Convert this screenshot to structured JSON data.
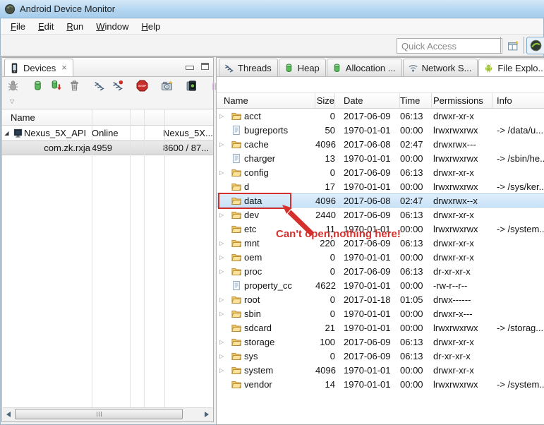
{
  "title_bar": {
    "title": "Android Device Monitor",
    "icon": "app-icon"
  },
  "menu_bar": {
    "items": [
      "File",
      "Edit",
      "Run",
      "Window",
      "Help"
    ]
  },
  "top_toolbar": {
    "quick_access_placeholder": "Quick Access",
    "perspective_button_icon": "open-perspective-icon",
    "ddms_button_icon": "ddms-perspective-icon"
  },
  "devices_panel": {
    "tab_label": "Devices",
    "tab_icon": "phone-icon",
    "toolbar_icons": [
      "debug-process",
      "sep",
      "update-heap",
      "dump-hprof",
      "cause-gc",
      "sep",
      "update-threads",
      "start-method-profiling",
      "sep",
      "stop-process",
      "sep",
      "screen-capture",
      "sep",
      "screen-record",
      "sep",
      "hierarchy-view",
      "capture-ok"
    ],
    "column_header": "Name",
    "rows": [
      {
        "name": "Nexus_5X_API",
        "status": "Online",
        "extra": "Nexus_5X...",
        "expanded": true,
        "selected": false,
        "icon": "device-icon"
      },
      {
        "name": "com.zk.rxja",
        "status": "4959",
        "extra": "8600 / 87...",
        "expanded": null,
        "selected": true,
        "icon": null
      }
    ]
  },
  "file_explorer": {
    "tabs": [
      {
        "label": "Threads",
        "icon": "threads-icon",
        "active": false,
        "closable": false
      },
      {
        "label": "Heap",
        "icon": "heap-icon",
        "active": false,
        "closable": false
      },
      {
        "label": "Allocation ...",
        "icon": "heap-icon",
        "active": false,
        "closable": false
      },
      {
        "label": "Network S...",
        "icon": "network-icon",
        "active": false,
        "closable": false
      },
      {
        "label": "File Explo...",
        "icon": "android-icon",
        "active": true,
        "closable": true
      }
    ],
    "partial_tab_icon": "emulator-control-icon",
    "columns": [
      "Name",
      "Size",
      "Date",
      "Time",
      "Permissions",
      "Info"
    ],
    "rows": [
      {
        "name": "acct",
        "type": "folder",
        "expandable": true,
        "size": "0",
        "date": "2017-06-09",
        "time": "06:13",
        "permissions": "drwxr-xr-x",
        "info": "",
        "selected": false,
        "boxed": false
      },
      {
        "name": "bugreports",
        "type": "file",
        "expandable": false,
        "size": "50",
        "date": "1970-01-01",
        "time": "00:00",
        "permissions": "lrwxrwxrwx",
        "info": "-> /data/u...",
        "selected": false,
        "boxed": false
      },
      {
        "name": "cache",
        "type": "folder",
        "expandable": true,
        "size": "4096",
        "date": "2017-06-08",
        "time": "02:47",
        "permissions": "drwxrwx---",
        "info": "",
        "selected": false,
        "boxed": false
      },
      {
        "name": "charger",
        "type": "file",
        "expandable": false,
        "size": "13",
        "date": "1970-01-01",
        "time": "00:00",
        "permissions": "lrwxrwxrwx",
        "info": "-> /sbin/he...",
        "selected": false,
        "boxed": false
      },
      {
        "name": "config",
        "type": "folder",
        "expandable": true,
        "size": "0",
        "date": "2017-06-09",
        "time": "06:13",
        "permissions": "drwxr-xr-x",
        "info": "",
        "selected": false,
        "boxed": false
      },
      {
        "name": "d",
        "type": "folder",
        "expandable": false,
        "size": "17",
        "date": "1970-01-01",
        "time": "00:00",
        "permissions": "lrwxrwxrwx",
        "info": "-> /sys/ker...",
        "selected": false,
        "boxed": false
      },
      {
        "name": "data",
        "type": "folder",
        "expandable": false,
        "size": "4096",
        "date": "2017-06-08",
        "time": "02:47",
        "permissions": "drwxrwx--x",
        "info": "",
        "selected": true,
        "boxed": true
      },
      {
        "name": "dev",
        "type": "folder",
        "expandable": true,
        "size": "2440",
        "date": "2017-06-09",
        "time": "06:13",
        "permissions": "drwxr-xr-x",
        "info": "",
        "selected": false,
        "boxed": false
      },
      {
        "name": "etc",
        "type": "folder",
        "expandable": false,
        "size": "11",
        "date": "1970-01-01",
        "time": "00:00",
        "permissions": "lrwxrwxrwx",
        "info": "-> /system...",
        "selected": false,
        "boxed": false
      },
      {
        "name": "mnt",
        "type": "folder",
        "expandable": true,
        "size": "220",
        "date": "2017-06-09",
        "time": "06:13",
        "permissions": "drwxr-xr-x",
        "info": "",
        "selected": false,
        "boxed": false
      },
      {
        "name": "oem",
        "type": "folder",
        "expandable": true,
        "size": "0",
        "date": "1970-01-01",
        "time": "00:00",
        "permissions": "drwxr-xr-x",
        "info": "",
        "selected": false,
        "boxed": false
      },
      {
        "name": "proc",
        "type": "folder",
        "expandable": true,
        "size": "0",
        "date": "2017-06-09",
        "time": "06:13",
        "permissions": "dr-xr-xr-x",
        "info": "",
        "selected": false,
        "boxed": false
      },
      {
        "name": "property_cc",
        "type": "file",
        "expandable": false,
        "size": "4622",
        "date": "1970-01-01",
        "time": "00:00",
        "permissions": "-rw-r--r--",
        "info": "",
        "selected": false,
        "boxed": false
      },
      {
        "name": "root",
        "type": "folder",
        "expandable": true,
        "size": "0",
        "date": "2017-01-18",
        "time": "01:05",
        "permissions": "drwx------",
        "info": "",
        "selected": false,
        "boxed": false
      },
      {
        "name": "sbin",
        "type": "folder",
        "expandable": true,
        "size": "0",
        "date": "1970-01-01",
        "time": "00:00",
        "permissions": "drwxr-x---",
        "info": "",
        "selected": false,
        "boxed": false
      },
      {
        "name": "sdcard",
        "type": "folder",
        "expandable": false,
        "size": "21",
        "date": "1970-01-01",
        "time": "00:00",
        "permissions": "lrwxrwxrwx",
        "info": "-> /storag...",
        "selected": false,
        "boxed": false
      },
      {
        "name": "storage",
        "type": "folder",
        "expandable": true,
        "size": "100",
        "date": "2017-06-09",
        "time": "06:13",
        "permissions": "drwxr-xr-x",
        "info": "",
        "selected": false,
        "boxed": false
      },
      {
        "name": "sys",
        "type": "folder",
        "expandable": true,
        "size": "0",
        "date": "2017-06-09",
        "time": "06:13",
        "permissions": "dr-xr-xr-x",
        "info": "",
        "selected": false,
        "boxed": false
      },
      {
        "name": "system",
        "type": "folder",
        "expandable": true,
        "size": "4096",
        "date": "1970-01-01",
        "time": "00:00",
        "permissions": "drwxr-xr-x",
        "info": "",
        "selected": false,
        "boxed": false
      },
      {
        "name": "vendor",
        "type": "folder",
        "expandable": false,
        "size": "14",
        "date": "1970-01-01",
        "time": "00:00",
        "permissions": "lrwxrwxrwx",
        "info": "-> /system...",
        "selected": false,
        "boxed": false
      }
    ],
    "annotation": {
      "text": "Can't open,nothing here!",
      "color": "#d5302e"
    }
  },
  "colors": {
    "titlebar_blue": "#b2d5f0",
    "selection_blue": "#cde6f9",
    "selection_gray": "#e4e4e4",
    "annotation_red": "#d5302e"
  }
}
